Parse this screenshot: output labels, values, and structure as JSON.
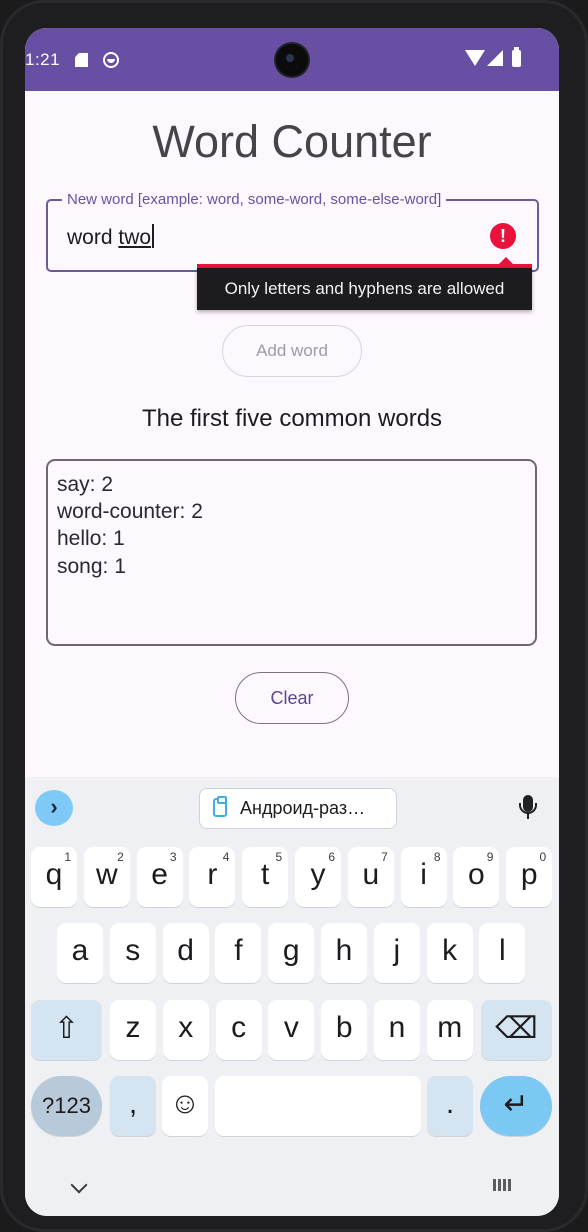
{
  "status_bar": {
    "time": "1:21"
  },
  "app": {
    "title": "Word Counter",
    "input": {
      "label": "New word [example: word, some-word, some-else-word]",
      "value_prefix": "word ",
      "value_underlined": "two",
      "error_tooltip": "Only letters and hyphens are allowed",
      "error_color": "#e8123b"
    },
    "add_button": "Add word",
    "results_title": "The first five common words",
    "results": [
      "say: 2",
      "word-counter: 2",
      "hello: 1",
      "song: 1"
    ],
    "clear_button": "Clear",
    "accent_color": "#6750a4"
  },
  "keyboard": {
    "clipboard_chip": "Андроид-раз…",
    "row1": [
      {
        "ch": "q",
        "hint": "1"
      },
      {
        "ch": "w",
        "hint": "2"
      },
      {
        "ch": "e",
        "hint": "3"
      },
      {
        "ch": "r",
        "hint": "4"
      },
      {
        "ch": "t",
        "hint": "5"
      },
      {
        "ch": "y",
        "hint": "6"
      },
      {
        "ch": "u",
        "hint": "7"
      },
      {
        "ch": "i",
        "hint": "8"
      },
      {
        "ch": "o",
        "hint": "9"
      },
      {
        "ch": "p",
        "hint": "0"
      }
    ],
    "row2": [
      "a",
      "s",
      "d",
      "f",
      "g",
      "h",
      "j",
      "k",
      "l"
    ],
    "row3": [
      "z",
      "x",
      "c",
      "v",
      "b",
      "n",
      "m"
    ],
    "symbols_key": "?123",
    "comma_key": ",",
    "period_key": ".",
    "shift_glyph": "⇧",
    "backspace_glyph": "⌫",
    "emoji_glyph": "☺",
    "enter_glyph": "↵",
    "toggle_glyph": "›"
  }
}
